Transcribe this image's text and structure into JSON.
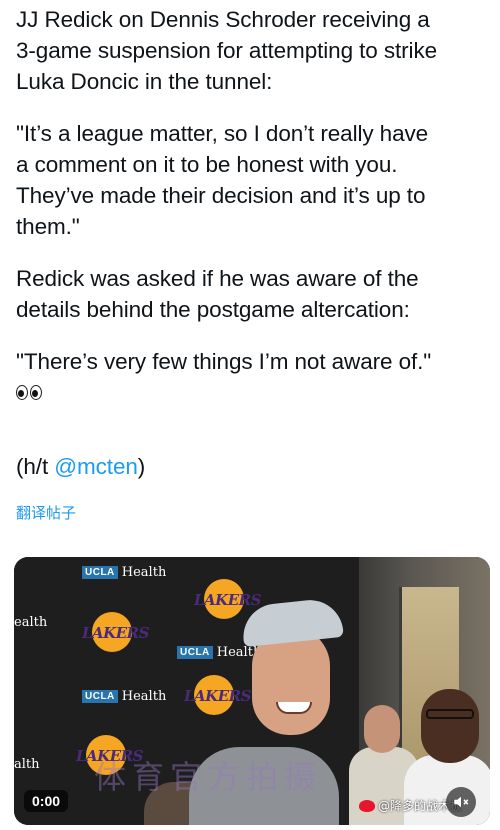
{
  "post": {
    "paragraph1": "JJ Redick on Dennis Schroder receiving a\n3-game suspension for attempting to strike\nLuka Doncic in the tunnel:",
    "paragraph2": "\"It’s a league matter, so I don’t really have\na comment on it to be honest with you.\nThey’ve made their decision and it’s up to\nthem.\"",
    "paragraph3": "Redick was asked if he was aware of the\ndetails behind the postgame altercation:",
    "paragraph4": "\"There’s very few things I’m not aware of.\"",
    "emoji": "eyes-emoji",
    "credit_prefix": "(h/t ",
    "credit_handle": "@mcten",
    "credit_suffix": ")",
    "translate_label": "翻译帖子"
  },
  "video": {
    "timecode": "0:00",
    "mute_icon": "mute-icon",
    "watermark_text": "体育官方拍摄",
    "source_handle": "@降多的战术板",
    "backdrop": {
      "ucla_box": "UCLA",
      "ucla_word": "Health",
      "lakers_word": "LAKERS",
      "partial_left_1": "ealth",
      "partial_left_2": "alth"
    }
  },
  "colors": {
    "text": "#0f1419",
    "link": "#1d9bf0",
    "lakers_gold": "#f5a623",
    "lakers_purple": "#4b2a7b",
    "ucla_blue": "#2774ae"
  }
}
